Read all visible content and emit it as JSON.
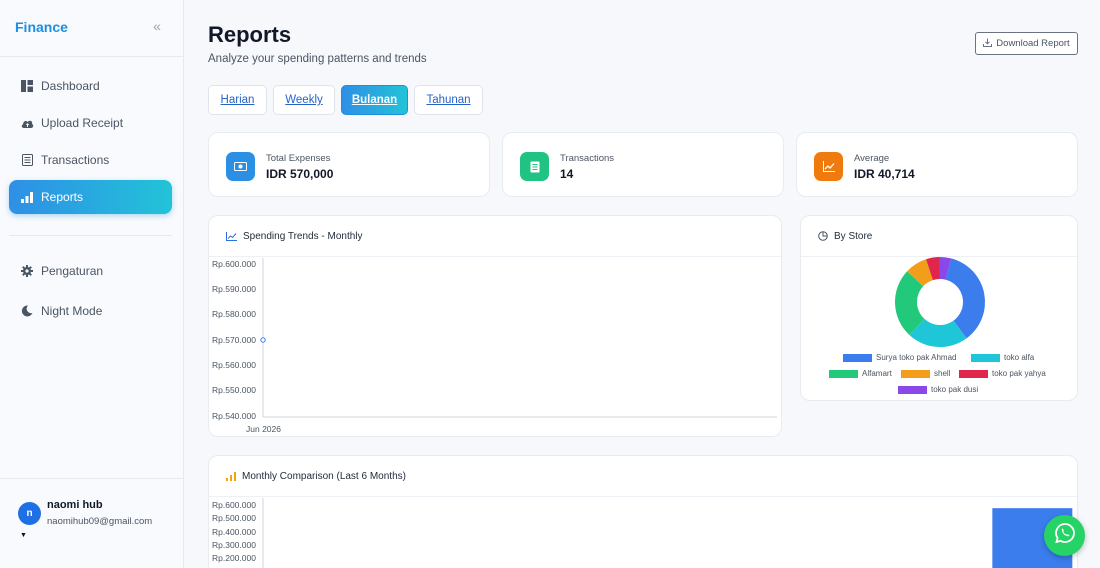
{
  "app": {
    "brand": "Finance"
  },
  "sidebar": {
    "collapse_icon": "double-chevron-left-icon",
    "items": [
      {
        "label": "Dashboard",
        "icon": "dashboard-icon"
      },
      {
        "label": "Upload Receipt",
        "icon": "cloud-upload-icon"
      },
      {
        "label": "Transactions",
        "icon": "receipt-icon"
      },
      {
        "label": "Reports",
        "icon": "bar-chart-icon",
        "active": true
      },
      {
        "label": "Pengaturan",
        "icon": "gear-icon"
      },
      {
        "label": "Night Mode",
        "icon": "moon-icon"
      }
    ],
    "user": {
      "initial": "n",
      "name": "naomi hub",
      "email": "naomihub09@gmail.com"
    }
  },
  "header": {
    "title": "Reports",
    "subtitle": "Analyze your spending patterns and trends",
    "download_label": "Download Report"
  },
  "tabs": [
    {
      "label": "Harian"
    },
    {
      "label": "Weekly"
    },
    {
      "label": "Bulanan",
      "active": true
    },
    {
      "label": "Tahunan"
    }
  ],
  "stats": [
    {
      "label": "Total Expenses",
      "value": "IDR 570,000",
      "color": "#2b8fe3",
      "icon": "money-icon"
    },
    {
      "label": "Transactions",
      "value": "14",
      "color": "#21c384",
      "icon": "receipt-icon"
    },
    {
      "label": "Average",
      "value": "IDR 40,714",
      "color": "#ef7a0e",
      "icon": "trend-chart-icon"
    }
  ],
  "spending_trends": {
    "title": "Spending Trends - Monthly",
    "y_ticks": [
      "Rp.600.000",
      "Rp.590.000",
      "Rp.580.000",
      "Rp.570.000",
      "Rp.560.000",
      "Rp.550.000",
      "Rp.540.000"
    ],
    "x_ticks": [
      "Jun 2026"
    ]
  },
  "by_store": {
    "title": "By Store"
  },
  "monthly_comparison": {
    "title": "Monthly Comparison (Last 6 Months)",
    "y_ticks": [
      "Rp.600.000",
      "Rp.500.000",
      "Rp.400.000",
      "Rp.300.000",
      "Rp.200.000"
    ]
  },
  "chart_data": [
    {
      "type": "line",
      "title": "Spending Trends - Monthly",
      "x": [
        "Jun 2026"
      ],
      "values": [
        570000
      ],
      "ylim": [
        540000,
        600000
      ],
      "grid": false
    },
    {
      "type": "pie",
      "title": "By Store",
      "donut": true,
      "labels": [
        "Surya toko pak Ahmad",
        "toko alfa",
        "Alfamart",
        "shell",
        "toko pak yahya",
        "toko pak dusi"
      ],
      "values": [
        36,
        22,
        25,
        8,
        5,
        4
      ],
      "colors": [
        "#3b7ded",
        "#1fc6d8",
        "#22c97a",
        "#f29e1a",
        "#e0264a",
        "#8b48e8"
      ],
      "legend": "bottom"
    },
    {
      "type": "bar",
      "title": "Monthly Comparison (Last 6 Months)",
      "categories": [
        "",
        "",
        "",
        "",
        "",
        ""
      ],
      "values": [
        0,
        0,
        0,
        0,
        0,
        570000
      ],
      "ylim": [
        100000,
        600000
      ],
      "color": "#3b7ded"
    }
  ],
  "fab": {
    "icon": "whatsapp-icon"
  }
}
